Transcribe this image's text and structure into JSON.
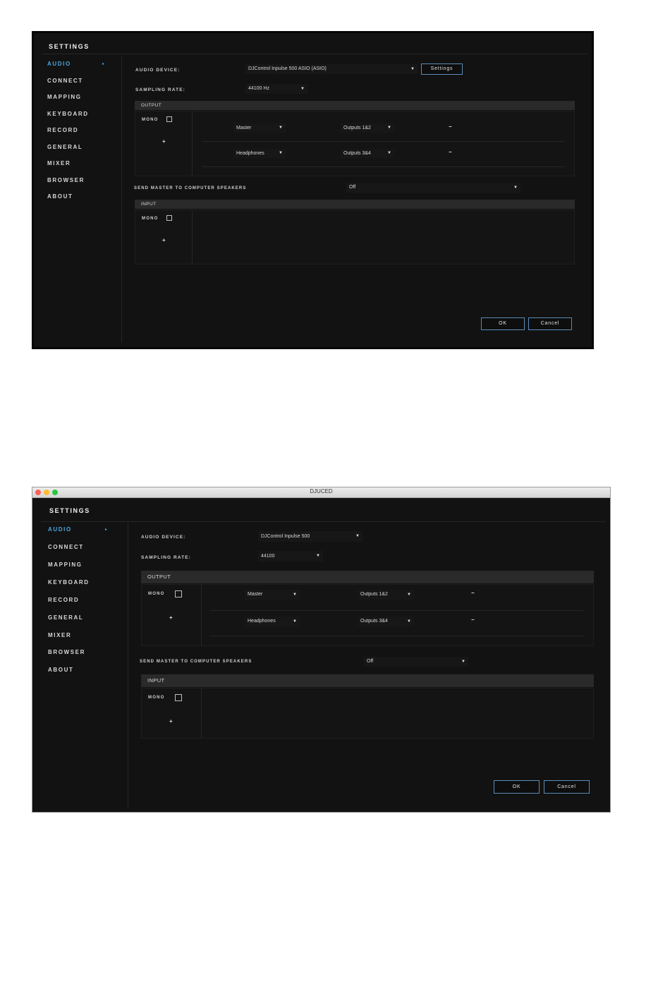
{
  "window2": {
    "title": "DJUCED",
    "dots": [
      "#ff5f57",
      "#febc2e",
      "#28c840"
    ]
  },
  "settings": {
    "heading": "SETTINGS",
    "sidebar": [
      {
        "label": "AUDIO",
        "active": true
      },
      {
        "label": "CONNECT"
      },
      {
        "label": "MAPPING"
      },
      {
        "label": "KEYBOARD"
      },
      {
        "label": "RECORD"
      },
      {
        "label": "GENERAL"
      },
      {
        "label": "MIXER"
      },
      {
        "label": "BROWSER"
      },
      {
        "label": "ABOUT"
      }
    ],
    "active_marker": "▸",
    "audio_device_label": "AUDIO DEVICE:",
    "sampling_rate_label": "SAMPLING RATE:",
    "output_header": "OUTPUT",
    "input_header": "INPUT",
    "mono_label": "MONO",
    "plus_symbol": "+",
    "minus_symbol": "−",
    "chevron": "▼",
    "outputs": [
      {
        "channel": "Master",
        "route": "Outputs 1&2"
      },
      {
        "channel": "Headphones",
        "route": "Outputs 3&4"
      }
    ],
    "send_master_label": "SEND MASTER TO COMPUTER SPEAKERS",
    "send_master_value": "Off",
    "ok_label": "OK",
    "cancel_label": "Cancel"
  },
  "screen1": {
    "audio_device_value": "DJControl Inpulse 500 ASIO (ASIO)",
    "settings_button": "Settings",
    "sampling_rate_value": "44100 Hz"
  },
  "screen2": {
    "audio_device_value": "DJControl Inpulse 500",
    "sampling_rate_value": "44100"
  },
  "colors": {
    "accent": "#4aa6e0",
    "button_border": "#5c8cb8",
    "background": "#121212"
  }
}
